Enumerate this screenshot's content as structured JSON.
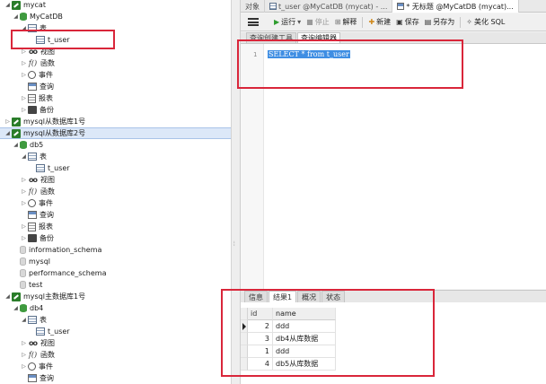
{
  "tree": [
    {
      "depth": 0,
      "twisty": "open",
      "icon": "conn",
      "label": "mycat"
    },
    {
      "depth": 1,
      "twisty": "open",
      "icon": "db",
      "label": "MyCatDB"
    },
    {
      "depth": 2,
      "twisty": "open",
      "icon": "tbl",
      "label": "表"
    },
    {
      "depth": 3,
      "twisty": "",
      "icon": "tbl",
      "label": "t_user"
    },
    {
      "depth": 2,
      "twisty": "closed",
      "icon": "view",
      "label": "视图"
    },
    {
      "depth": 2,
      "twisty": "closed",
      "icon": "func",
      "label": "函数"
    },
    {
      "depth": 2,
      "twisty": "closed",
      "icon": "event",
      "label": "事件"
    },
    {
      "depth": 2,
      "twisty": "",
      "icon": "query",
      "label": "查询"
    },
    {
      "depth": 2,
      "twisty": "closed",
      "icon": "report",
      "label": "报表"
    },
    {
      "depth": 2,
      "twisty": "closed",
      "icon": "backup",
      "label": "备份"
    },
    {
      "depth": 0,
      "twisty": "closed",
      "icon": "conn",
      "label": "mysql从数据库1号"
    },
    {
      "depth": 0,
      "twisty": "open",
      "icon": "conn",
      "label": "mysql从数据库2号",
      "selected": true
    },
    {
      "depth": 1,
      "twisty": "open",
      "icon": "db",
      "label": "db5"
    },
    {
      "depth": 2,
      "twisty": "open",
      "icon": "tbl",
      "label": "表"
    },
    {
      "depth": 3,
      "twisty": "",
      "icon": "tbl",
      "label": "t_user"
    },
    {
      "depth": 2,
      "twisty": "closed",
      "icon": "view",
      "label": "视图"
    },
    {
      "depth": 2,
      "twisty": "closed",
      "icon": "func",
      "label": "函数"
    },
    {
      "depth": 2,
      "twisty": "closed",
      "icon": "event",
      "label": "事件"
    },
    {
      "depth": 2,
      "twisty": "",
      "icon": "query",
      "label": "查询"
    },
    {
      "depth": 2,
      "twisty": "closed",
      "icon": "report",
      "label": "报表"
    },
    {
      "depth": 2,
      "twisty": "closed",
      "icon": "backup",
      "label": "备份"
    },
    {
      "depth": 1,
      "twisty": "",
      "icon": "schema",
      "label": "information_schema"
    },
    {
      "depth": 1,
      "twisty": "",
      "icon": "schema",
      "label": "mysql"
    },
    {
      "depth": 1,
      "twisty": "",
      "icon": "schema",
      "label": "performance_schema"
    },
    {
      "depth": 1,
      "twisty": "",
      "icon": "schema",
      "label": "test"
    },
    {
      "depth": 0,
      "twisty": "open",
      "icon": "conn",
      "label": "mysql主数据库1号"
    },
    {
      "depth": 1,
      "twisty": "open",
      "icon": "db",
      "label": "db4"
    },
    {
      "depth": 2,
      "twisty": "open",
      "icon": "tbl",
      "label": "表"
    },
    {
      "depth": 3,
      "twisty": "",
      "icon": "tbl",
      "label": "t_user"
    },
    {
      "depth": 2,
      "twisty": "closed",
      "icon": "view",
      "label": "视图"
    },
    {
      "depth": 2,
      "twisty": "closed",
      "icon": "func",
      "label": "函数"
    },
    {
      "depth": 2,
      "twisty": "closed",
      "icon": "event",
      "label": "事件"
    },
    {
      "depth": 2,
      "twisty": "",
      "icon": "query",
      "label": "查询"
    }
  ],
  "tabs": [
    {
      "label": "对象",
      "icon": ""
    },
    {
      "label": "t_user @MyCatDB (mycat) - ...",
      "icon": "tbl"
    },
    {
      "label": "* 无标题 @MyCatDB (mycat)...",
      "icon": "query",
      "active": true
    }
  ],
  "toolbar": {
    "run": "运行",
    "run_dropdown": "▾",
    "stop": "停止",
    "explain": "解释",
    "new": "新建",
    "save": "保存",
    "save_as": "另存为",
    "beautify": "美化 SQL"
  },
  "subtabs": [
    {
      "label": "查询创建工具"
    },
    {
      "label": "查询编辑器",
      "active": true
    }
  ],
  "editor": {
    "line_number": "1",
    "sql": "SELECT * from t_user"
  },
  "result_tabs": [
    {
      "label": "信息"
    },
    {
      "label": "结果1",
      "active": true
    },
    {
      "label": "概况"
    },
    {
      "label": "状态"
    }
  ],
  "grid": {
    "columns": [
      "id",
      "name"
    ],
    "rows": [
      {
        "id": "2",
        "name": "ddd"
      },
      {
        "id": "3",
        "name": "db4从库数据"
      },
      {
        "id": "1",
        "name": "ddd"
      },
      {
        "id": "4",
        "name": "db5从库数据"
      }
    ]
  },
  "colors": {
    "highlight_box": "#d9263a",
    "selection_blue": "#3f8ee3",
    "connection_green": "#2a7d2a"
  }
}
